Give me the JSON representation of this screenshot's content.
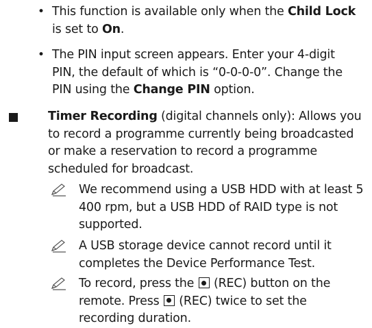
{
  "bullets": [
    {
      "pre": "This function is available only when the ",
      "bold1": "Child Lock",
      "mid": " is set to ",
      "bold2": "On",
      "post": "."
    },
    {
      "pre": "The PIN input screen appears. Enter your 4-digit PIN, the default of which is “0-0-0-0”. Change the PIN using the ",
      "bold": "Change PIN",
      "post": " option."
    }
  ],
  "timer": {
    "title": "Timer Recording",
    "desc": " (digital channels only): Allows you to record a programme currently being broadcasted or make a reservation to record a programme scheduled for broadcast."
  },
  "notes": [
    {
      "text": "We recommend using a USB HDD with at least 5 400 rpm, but a USB HDD of RAID type is not supported."
    },
    {
      "text": "A USB storage device cannot record until it completes the Device Performance Test."
    },
    {
      "pre": "To record, press the ",
      "rec1": "(REC) button on the remote. Press ",
      "rec2": "(REC) twice to set the recording duration."
    }
  ],
  "icons": {
    "section_marker": "square-bullet-icon",
    "note_marker": "pencil-note-icon",
    "rec_button": "rec-button-icon"
  }
}
